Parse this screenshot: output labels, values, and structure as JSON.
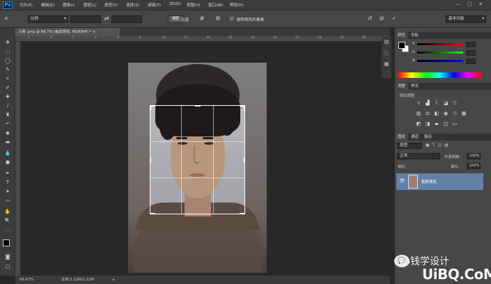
{
  "app": {
    "logo": "Ps"
  },
  "menu": [
    "文件(F)",
    "编辑(E)",
    "图像(I)",
    "图层(L)",
    "类型(Y)",
    "选择(S)",
    "滤镜(T)",
    "3D(D)",
    "视图(V)",
    "窗口(W)",
    "帮助(H)"
  ],
  "window_controls": [
    "—",
    "□",
    "✕"
  ],
  "options": {
    "ratio": "比例",
    "swap_icon": "swap-icon",
    "clear": "清除",
    "straighten": "拉直",
    "delete_cropped": "删除裁剪的像素",
    "workspace": "基本功能"
  },
  "document_tab": {
    "title": "人物 .png @ 66.7% (裁剪预览, RGB/8#) *",
    "close": "×"
  },
  "ruler_top_ticks": [
    "2",
    "0",
    "2",
    "4",
    "6",
    "8",
    "10",
    "12",
    "14",
    "16",
    "18",
    "20",
    "22",
    "24",
    "26",
    "28",
    "30"
  ],
  "status": {
    "zoom": "66.67%",
    "info": "文档:1.22M/1.22M"
  },
  "tools": [
    "move",
    "marquee",
    "lasso",
    "quick-select",
    "crop",
    "eyedropper",
    "healing",
    "brush",
    "stamp",
    "history-brush",
    "eraser",
    "gradient",
    "blur",
    "dodge",
    "pen",
    "type",
    "path-select",
    "shape",
    "hand",
    "zoom"
  ],
  "panels": {
    "color": {
      "tabs": [
        "颜色",
        "色板"
      ],
      "channels": [
        "R",
        "G",
        "B"
      ]
    },
    "adjustments": {
      "tabs": [
        "调整",
        "样式"
      ],
      "title": "添加调整"
    },
    "layers": {
      "tabs": [
        "图层",
        "通道",
        "路径"
      ],
      "kind": "类型",
      "blend": "正常",
      "opacity_label": "不透明度:",
      "opacity": "100%",
      "lock_label": "锁定:",
      "fill_label": "填充:",
      "fill": "100%",
      "layer_name": "裁剪预览"
    }
  },
  "watermark": {
    "line1": "小钱学设计",
    "line2": "UiBQ.CoM"
  }
}
